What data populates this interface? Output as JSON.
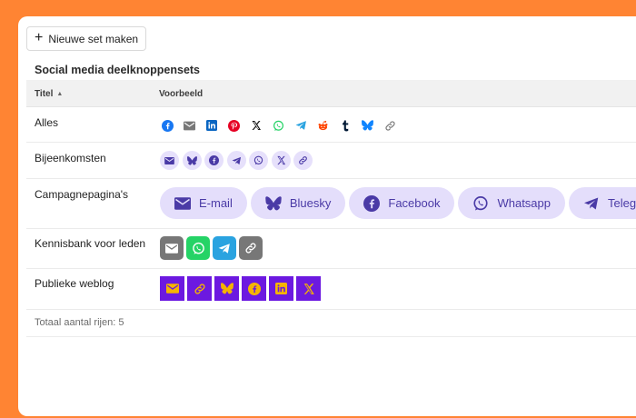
{
  "toolbar": {
    "new_set_label": "Nieuwe set maken",
    "plus_glyph": "+"
  },
  "section": {
    "title": "Social media deelknoppensets"
  },
  "table": {
    "columns": {
      "title": "Titel",
      "sort_glyph": "▲",
      "example": "Voorbeeld"
    },
    "rows": [
      {
        "title": "Alles",
        "style": "plain-color",
        "icons": [
          "facebook-icon",
          "email-icon",
          "linkedin-icon",
          "pinterest-icon",
          "x-icon",
          "whatsapp-icon",
          "telegram-icon",
          "reddit-icon",
          "tumblr-icon",
          "bluesky-icon",
          "link-icon"
        ]
      },
      {
        "title": "Bijeenkomsten",
        "style": "small-circle-lavender",
        "icons": [
          "email-icon",
          "bluesky-icon",
          "facebook-icon",
          "telegram-icon",
          "whatsapp-icon",
          "x-icon",
          "link-icon"
        ]
      },
      {
        "title": "Campagnepagina's",
        "style": "pill-with-label",
        "buttons": [
          {
            "icon": "email-icon",
            "label": "E-mail"
          },
          {
            "icon": "bluesky-icon",
            "label": "Bluesky"
          },
          {
            "icon": "facebook-icon",
            "label": "Facebook"
          },
          {
            "icon": "whatsapp-icon",
            "label": "Whatsapp"
          },
          {
            "icon": "telegram-icon",
            "label": "Telegra"
          }
        ]
      },
      {
        "title": "Kennisbank voor leden",
        "style": "rounded-square-brand",
        "icons": [
          "email-icon",
          "whatsapp-icon",
          "telegram-icon",
          "link-icon"
        ]
      },
      {
        "title": "Publieke weblog",
        "style": "square-purple-gold",
        "icons": [
          "email-icon",
          "link-icon",
          "bluesky-icon",
          "facebook-icon",
          "linkedin-icon",
          "x-icon"
        ]
      }
    ],
    "footer": "Totaal aantal rijen: 5"
  },
  "colors": {
    "page_bg": "#ff8433",
    "pill_bg": "#e4defb",
    "pill_fg": "#4a3aa6",
    "circle_bg": "#e6e0fb",
    "square_bg": "#6c19e0",
    "square_fg": "#f5b400",
    "email_gray": "#777777",
    "whatsapp_green": "#25d366",
    "telegram_blue": "#2aa3e0"
  }
}
